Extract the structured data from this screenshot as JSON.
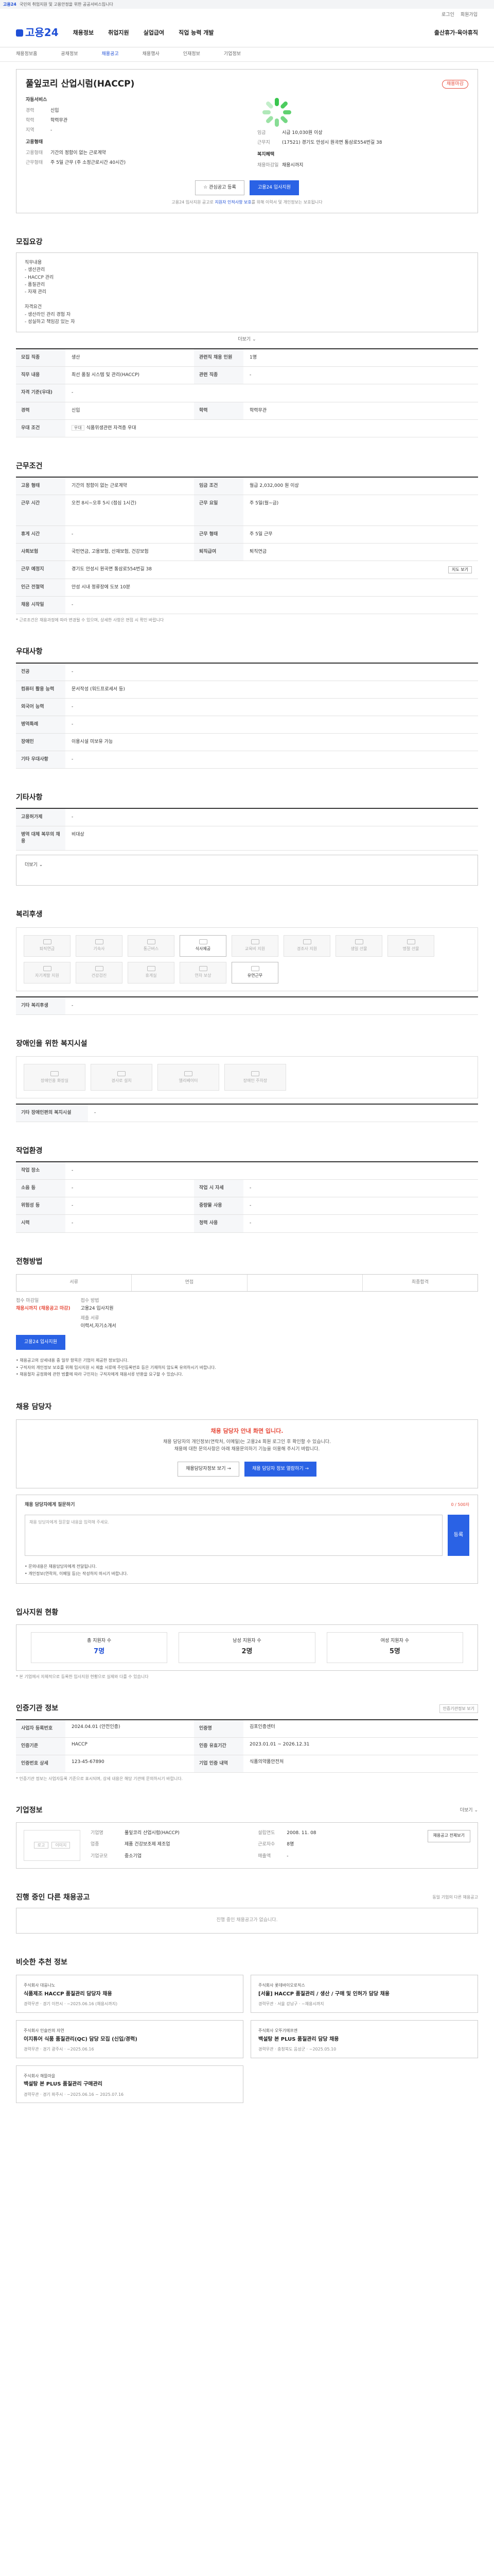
{
  "topbar": {
    "brand": "고용24",
    "notice": "국민의 취업지원 및 고용안정을 위한 공공서비스입니다"
  },
  "util": {
    "login": "로그인",
    "join": "회원가입"
  },
  "gnb": {
    "logo": "고용24",
    "menus": [
      "채용정보",
      "취업지원",
      "실업급여",
      "직업 능력 개발",
      "출산휴가·육아휴직"
    ]
  },
  "subnav": [
    "채용정보홈",
    "공채정보",
    "채용공고",
    "채용행사",
    "인재정보",
    "기업정보"
  ],
  "header": {
    "company": "풀잎코리 산업시럼(HACCP)",
    "badge": "채용마감",
    "left": {
      "sec": "자동서비스",
      "rows": [
        {
          "k": "경력",
          "v": "신입"
        },
        {
          "k": "학력",
          "v": "학력무관"
        },
        {
          "k": "지역",
          "v": "-"
        }
      ],
      "sec2": "고용형태",
      "rows2": [
        {
          "k": "고용형태",
          "v": "기간의 정함이 없는 근로계약"
        },
        {
          "k": "근무형태",
          "v": "주 5일 근무 (주 소정근로시간 40시간)"
        }
      ]
    },
    "right": {
      "rows": [
        {
          "k": "임금",
          "v": "시급 10,030원 이상"
        },
        {
          "k": "근무지",
          "v": "(17521) 경기도 안성시 원곡면 통삼로554번길 38"
        }
      ],
      "sec2": "복지혜택",
      "rows2": [
        {
          "k": "채용마감일",
          "v": "채용시까지"
        }
      ]
    },
    "btn_ghost": "☆ 관심공고 등록",
    "btn_pri": "고용24 입사지원",
    "note1": "고용24 입사지원 공고로 ",
    "note_link": "지원자 인적사항 보호",
    "note2": "를 위해 이력서 및 개인정보는 보호됩니다"
  },
  "recruit": {
    "title": "모집요강",
    "body": [
      "직무내용",
      "- 생산관리",
      "- HACCP 관리",
      "- 품질관리",
      "- 자재 관리",
      "",
      "자격요건",
      "- 생산라인 관리 경험 자",
      "- 성실하고 책임감 있는 자"
    ],
    "more": "더보기 ⌄",
    "table": [
      {
        "k": "모집 직종",
        "v": "생산",
        "k2": "관련직 채용 인원",
        "v2": "1명"
      },
      {
        "k": "직무 내용",
        "v": "최선 품질 시스템 및 관리(HACCP)",
        "k2": "관련 직종",
        "v2": "-"
      },
      {
        "k": "자격 기준(우대)",
        "v": "-"
      },
      {
        "k": "경력",
        "v": "신입",
        "k2": "학력",
        "v2": "학력무관"
      },
      {
        "k": "우대 조건",
        "v": "식품위생관련 자격증 우대",
        "tag": "우대"
      }
    ]
  },
  "work": {
    "title": "근무조건",
    "table": [
      {
        "k": "고용 형태",
        "v": "기간의 정함이 없는 근로계약",
        "k2": "임금 조건",
        "v2": "월급 2,032,000 원 이상"
      },
      {
        "k": "근무 시간",
        "v": "오전 8시~오후 5시 (점심 1시간)",
        "k2": "근무 요일",
        "v2": "주 5일(월~금)"
      },
      {
        "k": "휴게 시간",
        "v": "-",
        "k2": "근무 형태",
        "v2": "주 5일 근무"
      },
      {
        "k": "사회보험",
        "v": "국민연금, 고용보험, 산재보험, 건강보험",
        "k2": "퇴직급여",
        "v2": "퇴직연금"
      },
      {
        "k": "근무 예정지",
        "v": "경기도 안성시 원곡면 통삼로554번길 38",
        "btn": "지도 보기"
      },
      {
        "k": "인근 전철역",
        "v": "안성 시내 정류장에 도보 10분"
      },
      {
        "k": "채용 시작일",
        "v": "-"
      }
    ],
    "note": "* 근로조건은 채용과정에 따라 변경될 수 있으며, 상세한 사항은 면접 시 확인 바랍니다"
  },
  "edu": {
    "title": "우대사항",
    "table": [
      {
        "k": "전공",
        "v": "-"
      },
      {
        "k": "컴퓨터 활용 능력",
        "v": "문서작성 (워드프로세서 등)"
      },
      {
        "k": "외국어 능력",
        "v": "-"
      },
      {
        "k": "병역특례",
        "v": "-"
      },
      {
        "k": "장애인",
        "v": "이용시설 미보유 가능"
      },
      {
        "k": "기타 우대사항",
        "v": "-"
      }
    ]
  },
  "etc": {
    "title": "기타사항",
    "table": [
      {
        "k": "고용허가제",
        "v": "-"
      },
      {
        "k": "병역 대체 복무의 채용",
        "v": "비대상"
      }
    ],
    "more": "더보기 ⌄"
  },
  "welfare": {
    "title": "복리후생",
    "cards": [
      "퇴직연금",
      "기숙사",
      "통근버스",
      "식사제공",
      "교육비 지원",
      "경조사 지원",
      "생일 선물",
      "명절 선물",
      "자기계발 지원",
      "건강검진",
      "휴게실",
      "연차 보상",
      "유연근무"
    ],
    "on_index": [
      3,
      12
    ],
    "extra_k": "기타 복리후생",
    "extra_v": "-"
  },
  "disability": {
    "title": "장애인을 위한 복지시설",
    "cards": [
      "장애인용 화장실",
      "경사로 설치",
      "엘리베이터",
      "장애인 주차장"
    ],
    "extra_k": "기타 장애인편의 복지시설",
    "extra_v": "-"
  },
  "workenv": {
    "title": "작업환경",
    "table": [
      {
        "k": "작업 장소",
        "v": "-",
        "k2": "",
        "v2": ""
      },
      {
        "k": "소음 등",
        "v": "-",
        "k2": "작업 시 자세",
        "v2": "-"
      },
      {
        "k": "위험성 등",
        "v": "-",
        "k2": "중량물 사용",
        "v2": "-"
      },
      {
        "k": "시력",
        "v": "-",
        "k2": "청력 사용",
        "v2": "-"
      }
    ]
  },
  "method": {
    "title": "전형방법",
    "steps": [
      "서류",
      "면접",
      "",
      "최종합격"
    ],
    "apply": [
      {
        "lbl": "접수 마감일",
        "val": "채용시까지 (채용공고 마감)"
      },
      {
        "lbl": "접수 방법",
        "val": "고용24 입사지원",
        "n": true
      }
    ],
    "docs_lbl": "제출 서류",
    "docs": "이력서,자기소개서",
    "btn": "고용24 입사지원",
    "bullets": [
      "• 채용공고의 상세내용 중 일부 항목은 기업이 제공한 정보입니다.",
      "• 구직자의 개인정보 보호를 위해 입사지원 시 제출 서류에 주민등록번호 등은 기재하지 않도록 유의하시기 바랍니다.",
      "• 채용절차 공정화에 관한 법률에 따라 구인자는 구직자에게 채용서류 반환을 요구할 수 있습니다."
    ]
  },
  "alert": {
    "title": "채용 담당자",
    "ttl": "채용 담당자 안내 화면 입니다.",
    "body": [
      "채용 담당자의 개인정보(연락처, 이메일)는 고용24 회원 로그인 후 확인할 수 있습니다.",
      "채용에 대한 문의사항은 아래 채용문의하기 기능을 이용해 주시기 바랍니다."
    ],
    "btn1": "채용담당자정보 보기 →",
    "btn2": "채용 담당자 정보 열람하기 →",
    "q_lbl": "채용 담당자에게 질문하기",
    "q_ph": "채용 담당자에게 질문할 내용을 입력해 주세요.",
    "q_btn": "등록",
    "q_cnt": "0 / 500자",
    "q_notes": [
      "• 문의내용은 채용담당자에게 전달됩니다.",
      "• 개인정보(연락처, 이메일 등)는 작성하지 마시기 바랍니다."
    ]
  },
  "stats": {
    "title": "입사지원 현황",
    "items": [
      {
        "l": "총 지원자 수",
        "v": "7명"
      },
      {
        "l": "남성 지원자 수",
        "v": "2명"
      },
      {
        "l": "여성 지원자 수",
        "v": "5명"
      }
    ],
    "note": "* 본 기업에서 자체적으로 등록한 입사지원 현황으로 실제와 다를 수 있습니다"
  },
  "cert": {
    "title": "인증기관 정보",
    "btn": "인증기관정보 보기",
    "table": [
      {
        "k": "사업자 등록번호",
        "v": "2024.04.01 (안전인증)",
        "k2": "인증명",
        "v2": "김포인증센터"
      },
      {
        "k": "인증기준",
        "v": "HACCP",
        "k2": "인증 유효기간",
        "v2": "2023.01.01 ~ 2026.12.31"
      },
      {
        "k": "인증번호 상세",
        "v": "123-45-67890",
        "k2": "기업 인증 내역",
        "v2": "식품의약품안전처"
      }
    ],
    "note": "* 인증기관 정보는 사업자등록 기준으로 표시되며, 상세 내용은 해당 기관에 문의하시기 바랍니다."
  },
  "company": {
    "title": "기업정보",
    "more": "더보기 ⌄",
    "logo_pair": [
      "로고",
      "이미지"
    ],
    "grid": [
      {
        "k": "기업명",
        "v": "풀잎코리 산업시럼(HACCP)"
      },
      {
        "k": "설립연도",
        "v": "2008. 11. 08"
      },
      {
        "k": "업종",
        "v": "제품 건강보조제 제조업"
      },
      {
        "k": "근로자수",
        "v": "8명"
      },
      {
        "k": "기업규모",
        "v": "중소기업"
      },
      {
        "k": "매출액",
        "v": "-"
      }
    ],
    "cta": "채용공고 전체보기"
  },
  "other": {
    "title": "진행 중인 다른 채용공고",
    "sub": "동일 기업의 다른 채용공고",
    "empty": "진행 중인 채용공고가 없습니다."
  },
  "reco": {
    "title": "비슷한 추천 정보",
    "items": [
      {
        "co": "주식회사 대웅나노",
        "t": "식품제조 HACCP 품질관리 담당자 채용",
        "m": "경력무관 · 경기 이천시 · ~2025.06.16 (채용시까지)"
      },
      {
        "co": "주식회사 롯데바이오로직스",
        "t": "[서울] HACCP 품질관리 / 생산 / 구매 및 인허가 담당 채용",
        "m": "경력무관 · 서울 강남구 · ~채용시까지"
      },
      {
        "co": "주식회사 인슐린의 자연",
        "t": "이지튜어 식품 품질관리(QC) 담당 모집 (신입/경력)",
        "m": "경력무관 · 경기 광주시 · ~2025.06.16"
      },
      {
        "co": "주식회사 오뚜기에프엔",
        "t": "백설탕 본 PLUS 품질관리 담당 채용",
        "m": "경력무관 · 충청북도 음성군 · ~2025.05.10"
      },
      {
        "co": "주식회사 해뜰마을",
        "t": "백설탕 본 PLUS 품질관리 구매관리",
        "m": "경력무관 · 경기 파주시 · ~2025.06.16 ~ 2025.07.16"
      }
    ]
  }
}
